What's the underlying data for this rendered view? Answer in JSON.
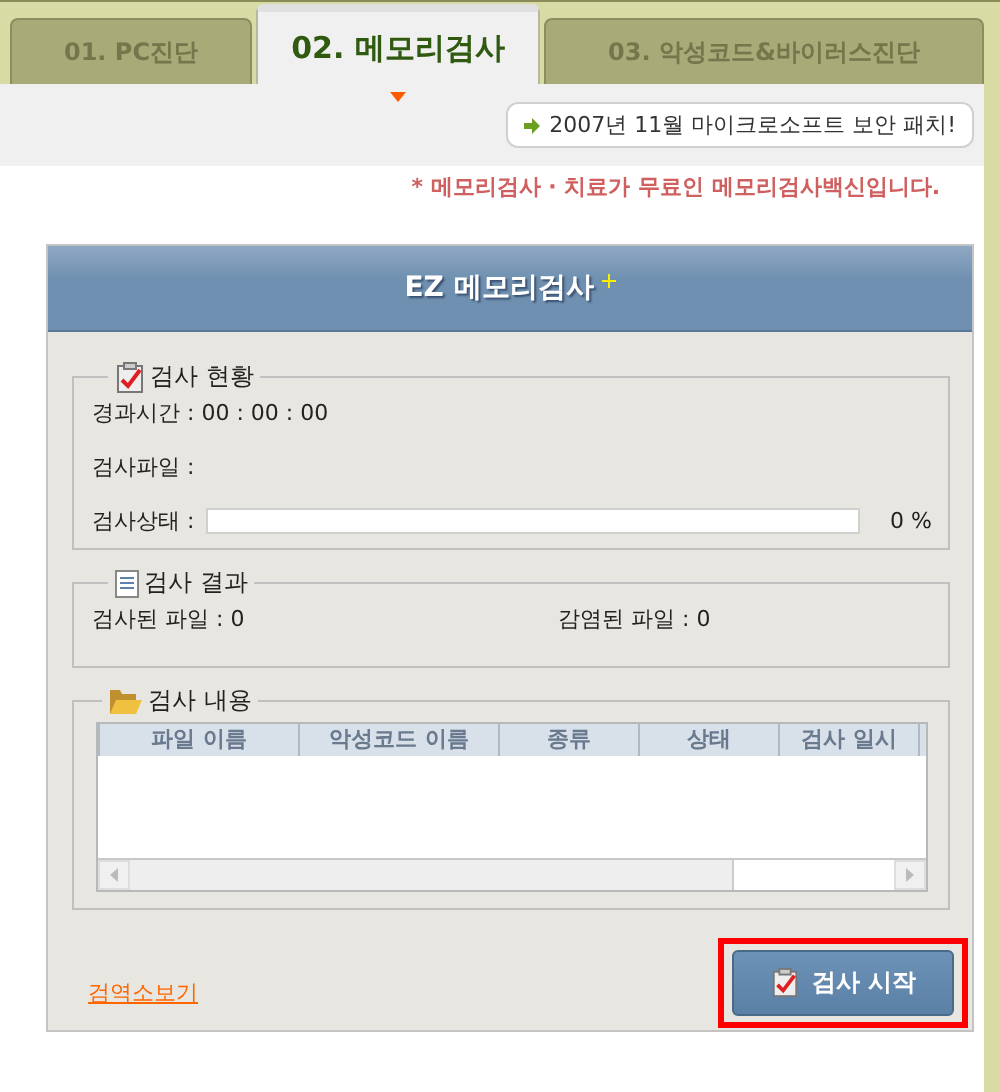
{
  "tabs": [
    {
      "label": "01. PC진단",
      "selected": false
    },
    {
      "label": "02. 메모리검사",
      "selected": true
    },
    {
      "label": "03. 악성코드&바이러스진단",
      "selected": false
    }
  ],
  "notice": {
    "text": "2007년 11월 마이크로소프트 보안 패치!"
  },
  "tagline": "* 메모리검사 · 치료가 무료인 메모리검사백신입니다.",
  "panel": {
    "title": "EZ 메모리검사"
  },
  "status_group": {
    "title": "검사 현황",
    "elapsed": "경과시간 : 00 : 00 : 00",
    "file": "검사파일 :",
    "state_label": "검사상태 :",
    "level": 0,
    "percent": "0 %"
  },
  "result_group": {
    "title": "검사 결과",
    "scanned": "검사된 파일 : 0",
    "infected": "감염된 파일 : 0"
  },
  "content_group": {
    "title": "검사 내용",
    "columns": [
      "파일 이름",
      "악성코드 이름",
      "종류",
      "상태",
      "검사 일시"
    ]
  },
  "footer": {
    "link": "검역소보기",
    "button": {
      "label": "검사 시작",
      "highlighted": true
    }
  }
}
